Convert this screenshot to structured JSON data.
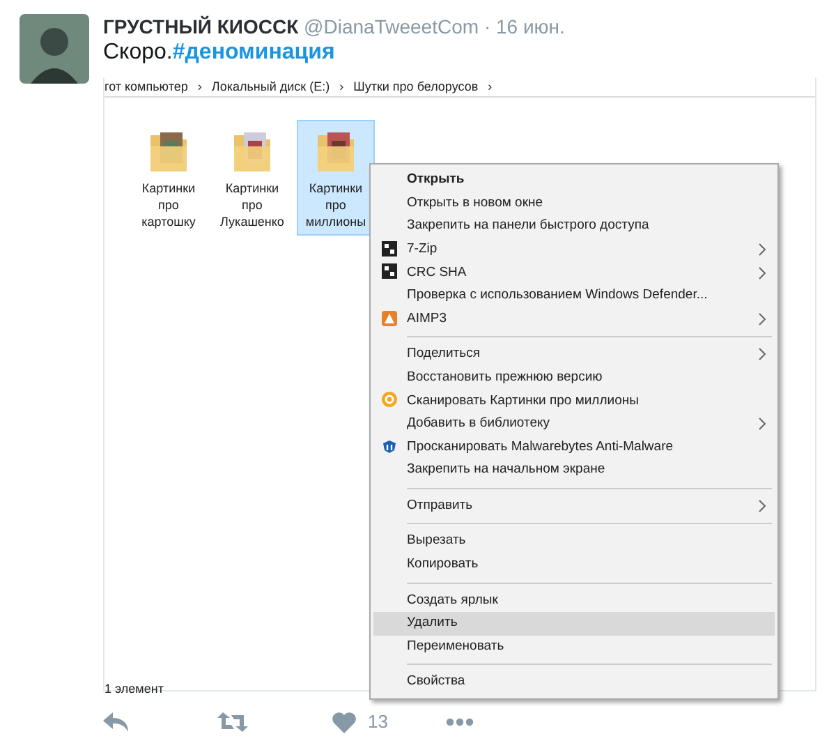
{
  "tweet": {
    "author": "ГРУСТНЫЙ КИОССК",
    "handle": "@DianaTweeetCom",
    "separator": "·",
    "date": "16 июн.",
    "text_plain": "Скоро.",
    "hashtag": "#деноминация"
  },
  "explorer": {
    "breadcrumb": [
      "гот компьютер",
      "Локальный диск (E:)",
      "Шутки про белорусов"
    ],
    "breadcrumb_sep": "›",
    "folders": [
      {
        "lines": [
          "Картинки",
          "про",
          "картошку"
        ],
        "selected": false
      },
      {
        "lines": [
          "Картинки",
          "про",
          "Лукашенко"
        ],
        "selected": false
      },
      {
        "lines": [
          "Картинки",
          "про",
          "миллионы"
        ],
        "selected": true
      }
    ],
    "status": "1 элемент"
  },
  "context_menu": [
    {
      "kind": "item",
      "label": "Открыть",
      "bold": true,
      "submenu": false,
      "highlighted": false
    },
    {
      "kind": "item",
      "label": "Открыть в новом окне",
      "bold": false,
      "submenu": false,
      "highlighted": false
    },
    {
      "kind": "item",
      "label": "Закрепить на панели быстрого доступа",
      "bold": false,
      "submenu": false,
      "highlighted": false
    },
    {
      "kind": "archive",
      "label": "7-Zip",
      "bold": false,
      "submenu": true,
      "highlighted": false
    },
    {
      "kind": "archive",
      "label": "CRC SHA",
      "bold": false,
      "submenu": true,
      "highlighted": false
    },
    {
      "kind": "item",
      "label": "Проверка с использованием Windows Defender...",
      "bold": false,
      "submenu": false,
      "highlighted": false
    },
    {
      "kind": "player",
      "label": "AIMP3",
      "bold": false,
      "submenu": true,
      "highlighted": false
    },
    {
      "kind": "separator"
    },
    {
      "kind": "item",
      "label": "Поделиться",
      "bold": false,
      "submenu": true,
      "highlighted": false
    },
    {
      "kind": "item",
      "label": "Восстановить прежнюю версию",
      "bold": false,
      "submenu": false,
      "highlighted": false
    },
    {
      "kind": "scan",
      "label": "Сканировать Картинки про миллионы",
      "bold": false,
      "submenu": false,
      "highlighted": false
    },
    {
      "kind": "item",
      "label": "Добавить в библиотеку",
      "bold": false,
      "submenu": true,
      "highlighted": false
    },
    {
      "kind": "shield",
      "label": "Просканировать Malwarebytes Anti-Malware",
      "bold": false,
      "submenu": false,
      "highlighted": false
    },
    {
      "kind": "item",
      "label": "Закрепить на начальном экране",
      "bold": false,
      "submenu": false,
      "highlighted": false
    },
    {
      "kind": "separator"
    },
    {
      "kind": "item",
      "label": "Отправить",
      "bold": false,
      "submenu": true,
      "highlighted": false
    },
    {
      "kind": "separator"
    },
    {
      "kind": "item",
      "label": "Вырезать",
      "bold": false,
      "submenu": false,
      "highlighted": false
    },
    {
      "kind": "item",
      "label": "Копировать",
      "bold": false,
      "submenu": false,
      "highlighted": false
    },
    {
      "kind": "separator"
    },
    {
      "kind": "item",
      "label": "Создать ярлык",
      "bold": false,
      "submenu": false,
      "highlighted": false
    },
    {
      "kind": "item",
      "label": "Удалить",
      "bold": false,
      "submenu": false,
      "highlighted": true
    },
    {
      "kind": "item",
      "label": "Переименовать",
      "bold": false,
      "submenu": false,
      "highlighted": false
    },
    {
      "kind": "separator"
    },
    {
      "kind": "item",
      "label": "Свойства",
      "bold": false,
      "submenu": false,
      "highlighted": false
    }
  ],
  "actions": [
    {
      "kind": "reply"
    },
    {
      "kind": "retweet"
    },
    {
      "kind": "like",
      "count": "13"
    },
    {
      "kind": "more"
    }
  ]
}
